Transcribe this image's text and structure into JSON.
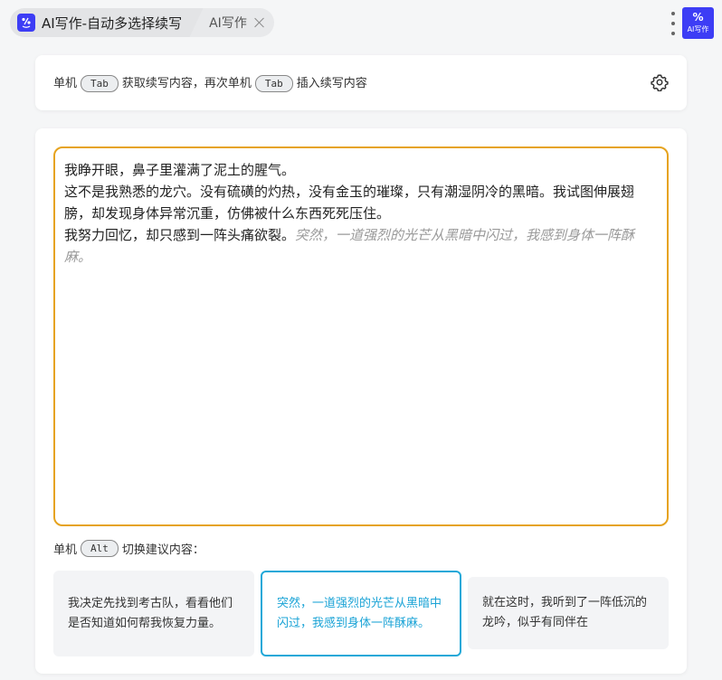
{
  "tabs": {
    "active_title": "AI写作-自动多选择续写",
    "inactive_title": "AI写作",
    "app_icon_glyph": "%",
    "app_icon_label": "AI写作"
  },
  "hint": {
    "part1": "单机",
    "key1": "Tab",
    "part2": "获取续写内容，再次单机",
    "key2": "Tab",
    "part3": "插入续写内容"
  },
  "editor": {
    "line1": "我睁开眼，鼻子里灌满了泥土的腥气。",
    "line2": "这不是我熟悉的龙穴。没有硫磺的灼热，没有金玉的璀璨，只有潮湿阴冷的黑暗。我试图伸展翅膀，却发现身体异常沉重，仿佛被什么东西死死压住。",
    "line3": "我努力回忆，却只感到一阵头痛欲裂。",
    "ghost_text": "突然，一道强烈的光芒从黑暗中闪过，我感到身体一阵酥麻。"
  },
  "alt_hint": {
    "part1": "单机",
    "key": "Alt",
    "part2": "切换建议内容："
  },
  "suggestions": [
    {
      "text": "我决定先找到考古队，看看他们是否知道如何帮我恢复力量。"
    },
    {
      "text": "突然，一道强烈的光芒从黑暗中闪过，我感到身体一阵酥麻。"
    },
    {
      "text": "就在这时，我听到了一阵低沉的龙吟，似乎有同伴在"
    }
  ],
  "colors": {
    "accent_border": "#e6a31e",
    "selected_suggestion": "#1fa8d8",
    "app_icon_bg": "#3d3df5"
  }
}
